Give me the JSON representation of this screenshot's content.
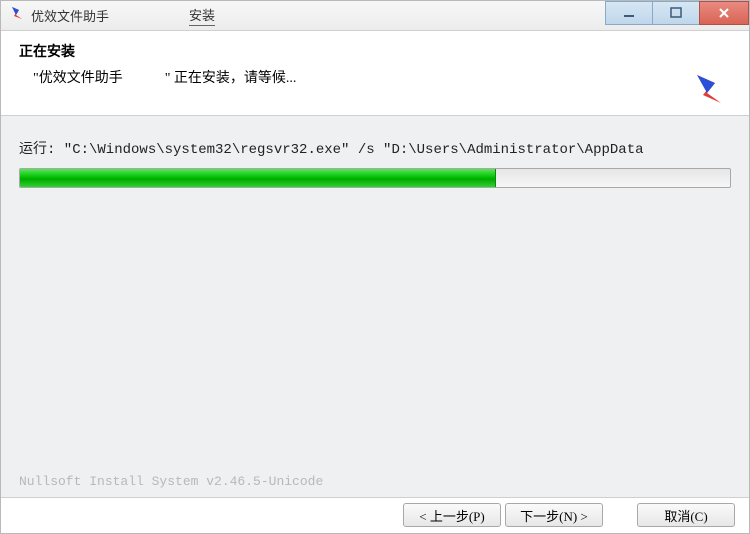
{
  "title_bar": {
    "app_name": "优效文件助手",
    "tab": "安装"
  },
  "header": {
    "title": "正在安装",
    "subtitle": "    \"优效文件助手            \" 正在安装，请等候..."
  },
  "body": {
    "command": "运行: \"C:\\Windows\\system32\\regsvr32.exe\" /s \"D:\\Users\\Administrator\\AppData",
    "progress_percent": 67
  },
  "footer": {
    "nullsoft": "Nullsoft Install System v2.46.5-Unicode"
  },
  "buttons": {
    "back": "< 上一步(P)",
    "next": "下一步(N) >",
    "cancel": "取消(C)"
  }
}
